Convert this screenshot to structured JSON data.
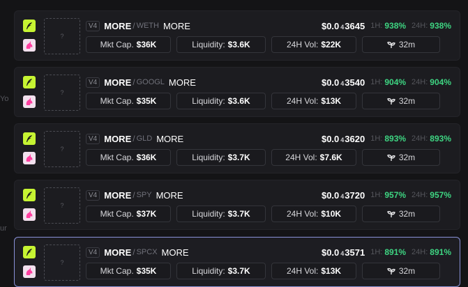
{
  "edge_fragments": [
    "Yo",
    "ur"
  ],
  "cards": [
    {
      "version": "V4",
      "symbol": "MORE",
      "pair": "WETH",
      "name": "MORE",
      "price_prefix": "$0.0",
      "price_zeros": "4",
      "price_digits": "3645",
      "h1_label": "1H:",
      "h1_value": "938%",
      "h24_label": "24H:",
      "h24_value": "938%",
      "mcap_label": "Mkt Cap.",
      "mcap_value": "$36K",
      "liq_label": "Liquidity:",
      "liq_value": "$3.6K",
      "vol_label": "24H Vol:",
      "vol_value": "$22K",
      "age": "32m",
      "selected": false
    },
    {
      "version": "V4",
      "symbol": "MORE",
      "pair": "GOOGL",
      "name": "MORE",
      "price_prefix": "$0.0",
      "price_zeros": "4",
      "price_digits": "3540",
      "h1_label": "1H:",
      "h1_value": "904%",
      "h24_label": "24H:",
      "h24_value": "904%",
      "mcap_label": "Mkt Cap.",
      "mcap_value": "$35K",
      "liq_label": "Liquidity:",
      "liq_value": "$3.6K",
      "vol_label": "24H Vol:",
      "vol_value": "$13K",
      "age": "32m",
      "selected": false
    },
    {
      "version": "V4",
      "symbol": "MORE",
      "pair": "GLD",
      "name": "MORE",
      "price_prefix": "$0.0",
      "price_zeros": "4",
      "price_digits": "3620",
      "h1_label": "1H:",
      "h1_value": "893%",
      "h24_label": "24H:",
      "h24_value": "893%",
      "mcap_label": "Mkt Cap.",
      "mcap_value": "$36K",
      "liq_label": "Liquidity:",
      "liq_value": "$3.7K",
      "vol_label": "24H Vol:",
      "vol_value": "$7.6K",
      "age": "32m",
      "selected": false
    },
    {
      "version": "V4",
      "symbol": "MORE",
      "pair": "SPY",
      "name": "MORE",
      "price_prefix": "$0.0",
      "price_zeros": "4",
      "price_digits": "3720",
      "h1_label": "1H:",
      "h1_value": "957%",
      "h24_label": "24H:",
      "h24_value": "957%",
      "mcap_label": "Mkt Cap.",
      "mcap_value": "$37K",
      "liq_label": "Liquidity:",
      "liq_value": "$3.7K",
      "vol_label": "24H Vol:",
      "vol_value": "$10K",
      "age": "32m",
      "selected": false
    },
    {
      "version": "V4",
      "symbol": "MORE",
      "pair": "SPCX",
      "name": "MORE",
      "price_prefix": "$0.0",
      "price_zeros": "4",
      "price_digits": "3571",
      "h1_label": "1H:",
      "h1_value": "891%",
      "h24_label": "24H:",
      "h24_value": "891%",
      "mcap_label": "Mkt Cap.",
      "mcap_value": "$35K",
      "liq_label": "Liquidity:",
      "liq_value": "$3.7K",
      "vol_label": "24H Vol:",
      "vol_value": "$13K",
      "age": "32m",
      "selected": true
    }
  ],
  "colors": {
    "accent_lime": "#c6f432",
    "positive": "#3ed582",
    "selected_border": "#8a92d8"
  },
  "icons": {
    "dex_badge": "feather-icon",
    "chain_badge": "unicorn-icon",
    "age": "sprout-icon",
    "thumb": "image-placeholder-icon"
  }
}
